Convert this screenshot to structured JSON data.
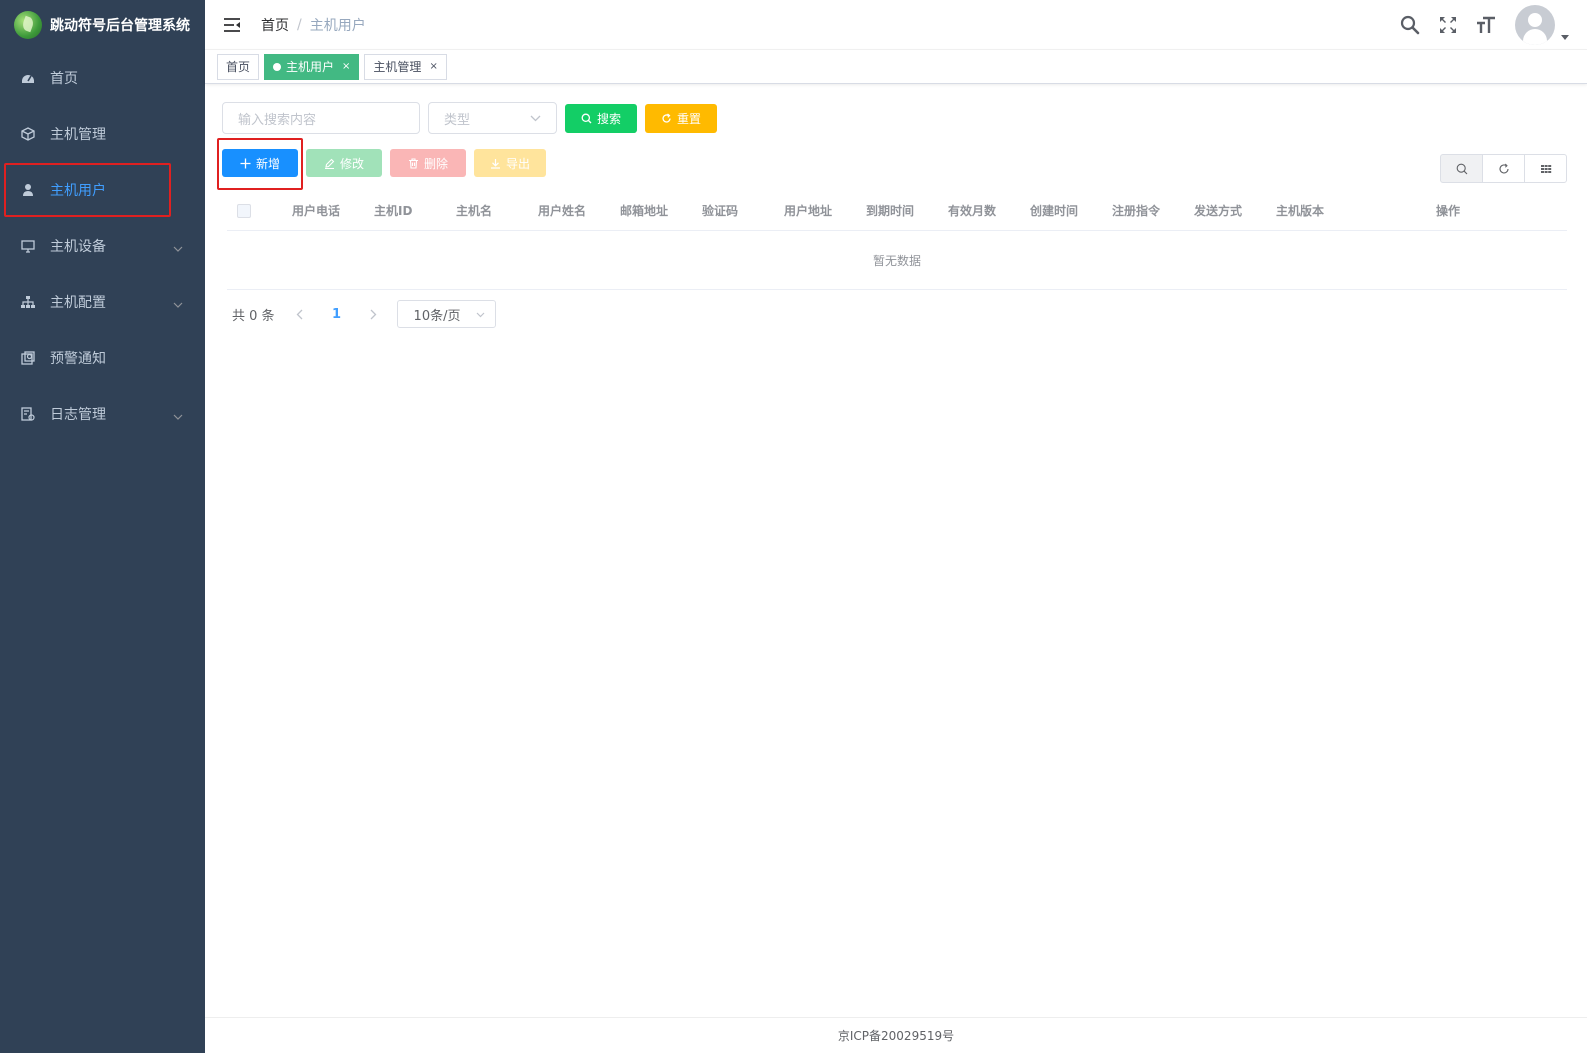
{
  "app": {
    "title": "跳动符号后台管理系统"
  },
  "sidebar": {
    "items": [
      {
        "label": "首页",
        "icon": "dashboard-icon",
        "active": false,
        "has_submenu": false
      },
      {
        "label": "主机管理",
        "icon": "cube-icon",
        "active": false,
        "has_submenu": false
      },
      {
        "label": "主机用户",
        "icon": "user-icon",
        "active": true,
        "has_submenu": false
      },
      {
        "label": "主机设备",
        "icon": "monitor-icon",
        "active": false,
        "has_submenu": true
      },
      {
        "label": "主机配置",
        "icon": "tree-icon",
        "active": false,
        "has_submenu": true
      },
      {
        "label": "预警通知",
        "icon": "alert-icon",
        "active": false,
        "has_submenu": false
      },
      {
        "label": "日志管理",
        "icon": "log-icon",
        "active": false,
        "has_submenu": true
      }
    ]
  },
  "header": {
    "breadcrumb": {
      "home": "首页",
      "separator": "/",
      "current": "主机用户"
    }
  },
  "tags": [
    {
      "label": "首页",
      "active": false,
      "closable": false
    },
    {
      "label": "主机用户",
      "active": true,
      "closable": true
    },
    {
      "label": "主机管理",
      "active": false,
      "closable": true
    }
  ],
  "search": {
    "input_placeholder": "输入搜索内容",
    "type_placeholder": "类型",
    "search_label": "搜索",
    "reset_label": "重置"
  },
  "toolbar": {
    "add_label": "新增",
    "edit_label": "修改",
    "delete_label": "删除",
    "export_label": "导出"
  },
  "table": {
    "columns": [
      "用户电话",
      "主机ID",
      "主机名",
      "用户姓名",
      "邮箱地址",
      "验证码",
      "用户地址",
      "到期时间",
      "有效月数",
      "创建时间",
      "注册指令",
      "发送方式",
      "主机版本",
      "操作"
    ],
    "empty_text": "暂无数据"
  },
  "pagination": {
    "total_text": "共 0 条",
    "current_page": "1",
    "page_size": "10条/页"
  },
  "footer": {
    "icp": "京ICP备20029519号"
  },
  "colors": {
    "sidebar_bg": "#304156",
    "primary": "#1890ff",
    "success": "#13ce66",
    "warning": "#ffba00",
    "tag_active": "#42b983",
    "highlight": "#e02020"
  }
}
